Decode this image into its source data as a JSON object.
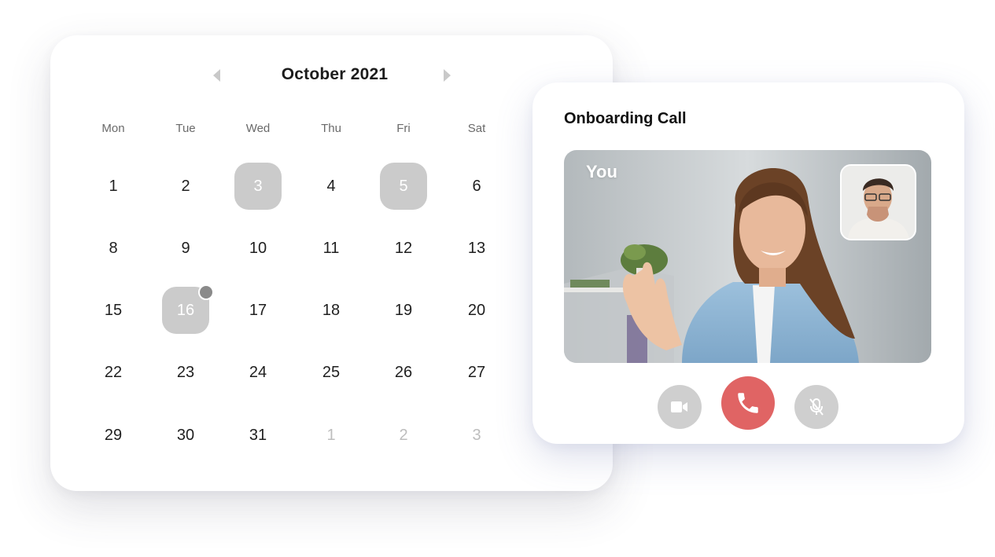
{
  "calendar": {
    "month_title": "October 2021",
    "prev_icon": "chevron-left-icon",
    "next_icon": "chevron-right-icon",
    "weekdays": [
      "Mon",
      "Tue",
      "Wed",
      "Thu",
      "Fri",
      "Sat"
    ],
    "weeks": [
      [
        {
          "label": "1"
        },
        {
          "label": "2"
        },
        {
          "label": "3",
          "highlighted": true
        },
        {
          "label": "4"
        },
        {
          "label": "5",
          "highlighted": true
        },
        {
          "label": "6"
        }
      ],
      [
        {
          "label": "8"
        },
        {
          "label": "9"
        },
        {
          "label": "10"
        },
        {
          "label": "11"
        },
        {
          "label": "12"
        },
        {
          "label": "13"
        }
      ],
      [
        {
          "label": "15"
        },
        {
          "label": "16",
          "highlighted": true,
          "has_event_dot": true
        },
        {
          "label": "17"
        },
        {
          "label": "18"
        },
        {
          "label": "19"
        },
        {
          "label": "20"
        }
      ],
      [
        {
          "label": "22"
        },
        {
          "label": "23"
        },
        {
          "label": "24"
        },
        {
          "label": "25"
        },
        {
          "label": "26"
        },
        {
          "label": "27"
        }
      ],
      [
        {
          "label": "29"
        },
        {
          "label": "30"
        },
        {
          "label": "31"
        },
        {
          "label": "1",
          "muted": true
        },
        {
          "label": "2",
          "muted": true
        },
        {
          "label": "3",
          "muted": true
        }
      ]
    ]
  },
  "call": {
    "title": "Onboarding Call",
    "self_label": "You",
    "controls": [
      {
        "name": "camera-button",
        "icon": "video-camera-icon",
        "color": "#cfcfcf"
      },
      {
        "name": "end-call-button",
        "icon": "phone-icon",
        "color": "#e06464"
      },
      {
        "name": "mute-button",
        "icon": "microphone-off-icon",
        "color": "#cfcfcf"
      }
    ]
  },
  "colors": {
    "highlight_day": "#cbcbcb",
    "event_dot": "#8a8a8a",
    "end_call": "#e06464",
    "control_gray": "#cfcfcf",
    "muted_day": "#bdbdbd"
  }
}
